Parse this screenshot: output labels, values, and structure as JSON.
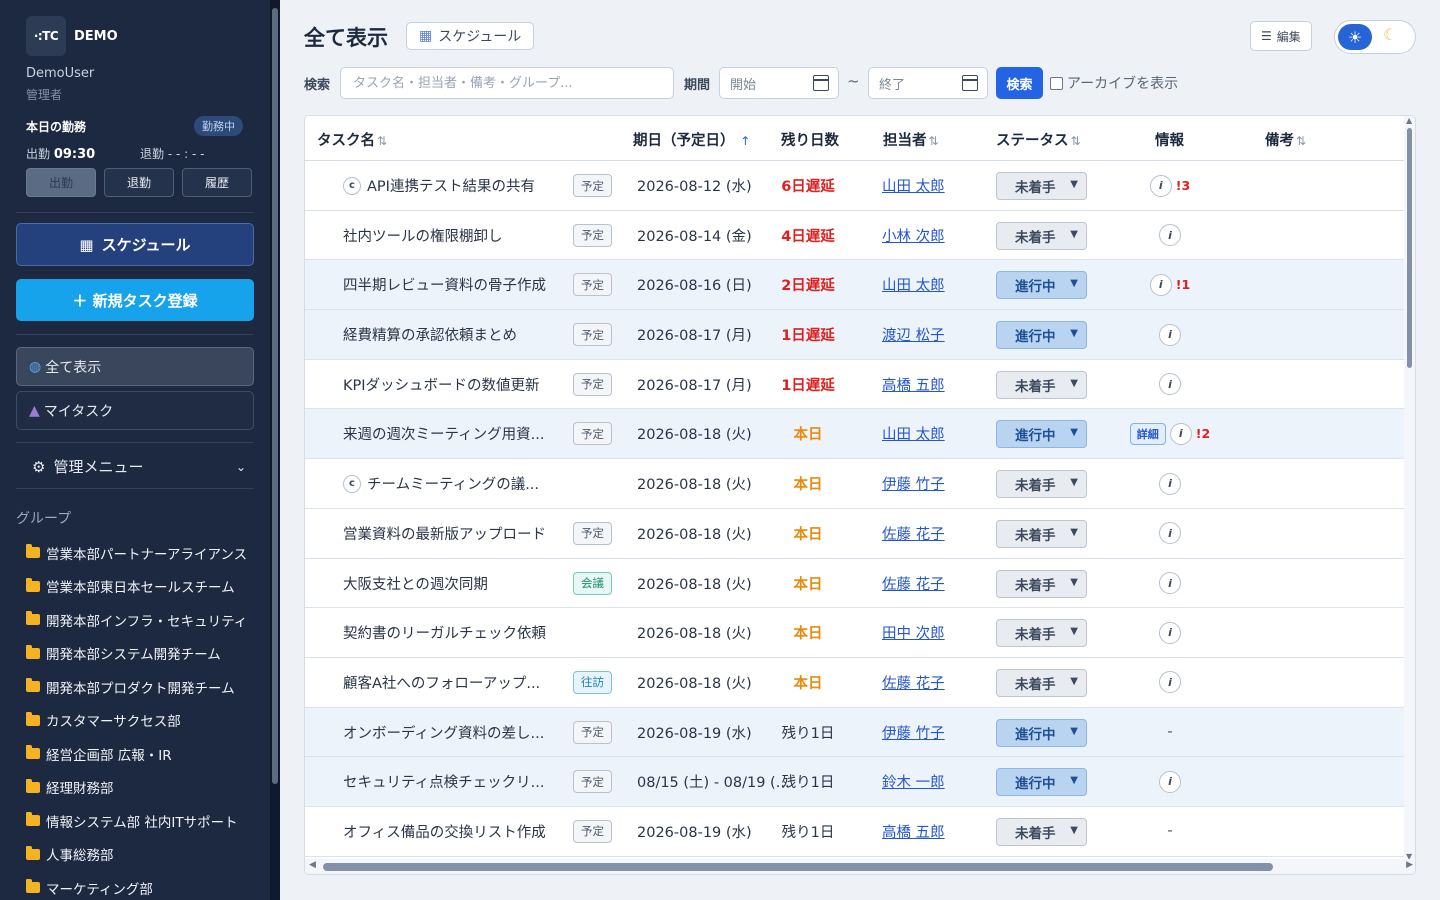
{
  "brand": {
    "logo": "·:TC",
    "demo": "DEMO"
  },
  "user": {
    "name": "DemoUser",
    "role": "管理者"
  },
  "attendance": {
    "title": "本日の勤務",
    "badge": "勤務中",
    "in_label": "出勤",
    "in_time": "09:30",
    "out_label": "退勤",
    "out_time": "- - : - -",
    "buttons": [
      "出勤",
      "退勤",
      "履歴"
    ]
  },
  "sidebar": {
    "schedule_button": "スケジュール",
    "new_task_button": "＋ 新規タスク登録",
    "nav": [
      "全て表示",
      "マイタスク"
    ],
    "admin_menu": "管理メニュー",
    "group_title": "グループ",
    "groups": [
      "営業本部パートナーアライアンス",
      "営業本部東日本セールスチーム",
      "開発本部インフラ・セキュリティ",
      "開発本部システム開発チーム",
      "開発本部プロダクト開発チーム",
      "カスタマーサクセス部",
      "経営企画部 広報・IR",
      "経理財務部",
      "情報システム部 社内ITサポート",
      "人事総務部",
      "マーケティング部"
    ]
  },
  "header": {
    "title": "全て表示",
    "schedule_chip": "スケジュール",
    "edit_button": "編集"
  },
  "filters": {
    "search_label": "検索",
    "search_placeholder": "タスク名・担当者・備考・グループ...",
    "period_label": "期間",
    "start_placeholder": "開始",
    "end_placeholder": "終了",
    "tilde": "~",
    "search_button": "検索",
    "archive_label": "アーカイブを表示"
  },
  "table": {
    "columns": {
      "task": "タスク名",
      "due": "期日（予定日）",
      "remaining": "残り日数",
      "assignee": "担当者",
      "status": "ステータス",
      "info": "情報",
      "notes": "備考"
    },
    "rows": [
      {
        "c": true,
        "name": "API連携テスト結果の共有",
        "tag": "予定",
        "tag_style": "gray",
        "due": "2026-08-12 (水)",
        "remaining": "6日遅延",
        "rem_style": "red",
        "assignee": "山田 太郎",
        "status": "未着手",
        "detail": false,
        "alert": "!3",
        "info_icon": true,
        "hl": false
      },
      {
        "c": false,
        "name": "社内ツールの権限棚卸し",
        "tag": "予定",
        "tag_style": "gray",
        "due": "2026-08-14 (金)",
        "remaining": "4日遅延",
        "rem_style": "red",
        "assignee": "小林 次郎",
        "status": "未着手",
        "detail": false,
        "alert": "",
        "info_icon": true,
        "hl": false
      },
      {
        "c": false,
        "name": "四半期レビュー資料の骨子作成",
        "tag": "予定",
        "tag_style": "gray",
        "due": "2026-08-16 (日)",
        "remaining": "2日遅延",
        "rem_style": "red",
        "assignee": "山田 太郎",
        "status": "進行中",
        "detail": false,
        "alert": "!1",
        "info_icon": true,
        "hl": true
      },
      {
        "c": false,
        "name": "経費精算の承認依頼まとめ",
        "tag": "予定",
        "tag_style": "gray",
        "due": "2026-08-17 (月)",
        "remaining": "1日遅延",
        "rem_style": "red",
        "assignee": "渡辺 松子",
        "status": "進行中",
        "detail": false,
        "alert": "",
        "info_icon": true,
        "hl": true
      },
      {
        "c": false,
        "name": "KPIダッシュボードの数値更新",
        "tag": "予定",
        "tag_style": "gray",
        "due": "2026-08-17 (月)",
        "remaining": "1日遅延",
        "rem_style": "red",
        "assignee": "高橋 五郎",
        "status": "未着手",
        "detail": false,
        "alert": "",
        "info_icon": true,
        "hl": false
      },
      {
        "c": false,
        "name": "来週の週次ミーティング用資...",
        "tag": "予定",
        "tag_style": "gray",
        "due": "2026-08-18 (火)",
        "remaining": "本日",
        "rem_style": "orange",
        "assignee": "山田 太郎",
        "status": "進行中",
        "detail": true,
        "alert": "!2",
        "info_icon": true,
        "hl": true
      },
      {
        "c": true,
        "name": "チームミーティングの議...",
        "tag": "",
        "tag_style": "gray",
        "due": "2026-08-18 (火)",
        "remaining": "本日",
        "rem_style": "orange",
        "assignee": "伊藤 竹子",
        "status": "未着手",
        "detail": false,
        "alert": "",
        "info_icon": true,
        "hl": false
      },
      {
        "c": false,
        "name": "営業資料の最新版アップロード",
        "tag": "予定",
        "tag_style": "gray",
        "due": "2026-08-18 (火)",
        "remaining": "本日",
        "rem_style": "orange",
        "assignee": "佐藤 花子",
        "status": "未着手",
        "detail": false,
        "alert": "",
        "info_icon": true,
        "hl": false
      },
      {
        "c": false,
        "name": "大阪支社との週次同期",
        "tag": "会議",
        "tag_style": "green",
        "due": "2026-08-18 (火)",
        "remaining": "本日",
        "rem_style": "orange",
        "assignee": "佐藤 花子",
        "status": "未着手",
        "detail": false,
        "alert": "",
        "info_icon": true,
        "hl": false
      },
      {
        "c": false,
        "name": "契約書のリーガルチェック依頼",
        "tag": "",
        "tag_style": "gray",
        "due": "2026-08-18 (火)",
        "remaining": "本日",
        "rem_style": "orange",
        "assignee": "田中 次郎",
        "status": "未着手",
        "detail": false,
        "alert": "",
        "info_icon": true,
        "hl": false
      },
      {
        "c": false,
        "name": "顧客A社へのフォローアップ...",
        "tag": "往訪",
        "tag_style": "blue",
        "due": "2026-08-18 (火)",
        "remaining": "本日",
        "rem_style": "orange",
        "assignee": "佐藤 花子",
        "status": "未着手",
        "detail": false,
        "alert": "",
        "info_icon": true,
        "hl": false
      },
      {
        "c": false,
        "name": "オンボーディング資料の差し...",
        "tag": "予定",
        "tag_style": "gray",
        "due": "2026-08-19 (水)",
        "remaining": "残り1日",
        "rem_style": "normal",
        "assignee": "伊藤 竹子",
        "status": "進行中",
        "detail": false,
        "alert": "",
        "info_icon": false,
        "hl": true
      },
      {
        "c": false,
        "name": "セキュリティ点検チェックリ...",
        "tag": "予定",
        "tag_style": "gray",
        "due": "08/15 (土) - 08/19 (...",
        "remaining": "残り1日",
        "rem_style": "normal",
        "assignee": "鈴木 一郎",
        "status": "進行中",
        "detail": false,
        "alert": "",
        "info_icon": true,
        "hl": true
      },
      {
        "c": false,
        "name": "オフィス備品の交換リスト作成",
        "tag": "予定",
        "tag_style": "gray",
        "due": "2026-08-19 (水)",
        "remaining": "残り1日",
        "rem_style": "normal",
        "assignee": "高橋 五郎",
        "status": "未着手",
        "detail": false,
        "alert": "",
        "info_icon": false,
        "hl": false
      }
    ],
    "detail_label": "詳細",
    "info_glyph": "i",
    "c_glyph": "c",
    "dash": "-"
  },
  "colors": {
    "accent": "#2264e3",
    "sidebar_bg": "#1c2941",
    "new_button": "#16a3ec",
    "overdue": "#e0201e",
    "today": "#e88b0c"
  }
}
